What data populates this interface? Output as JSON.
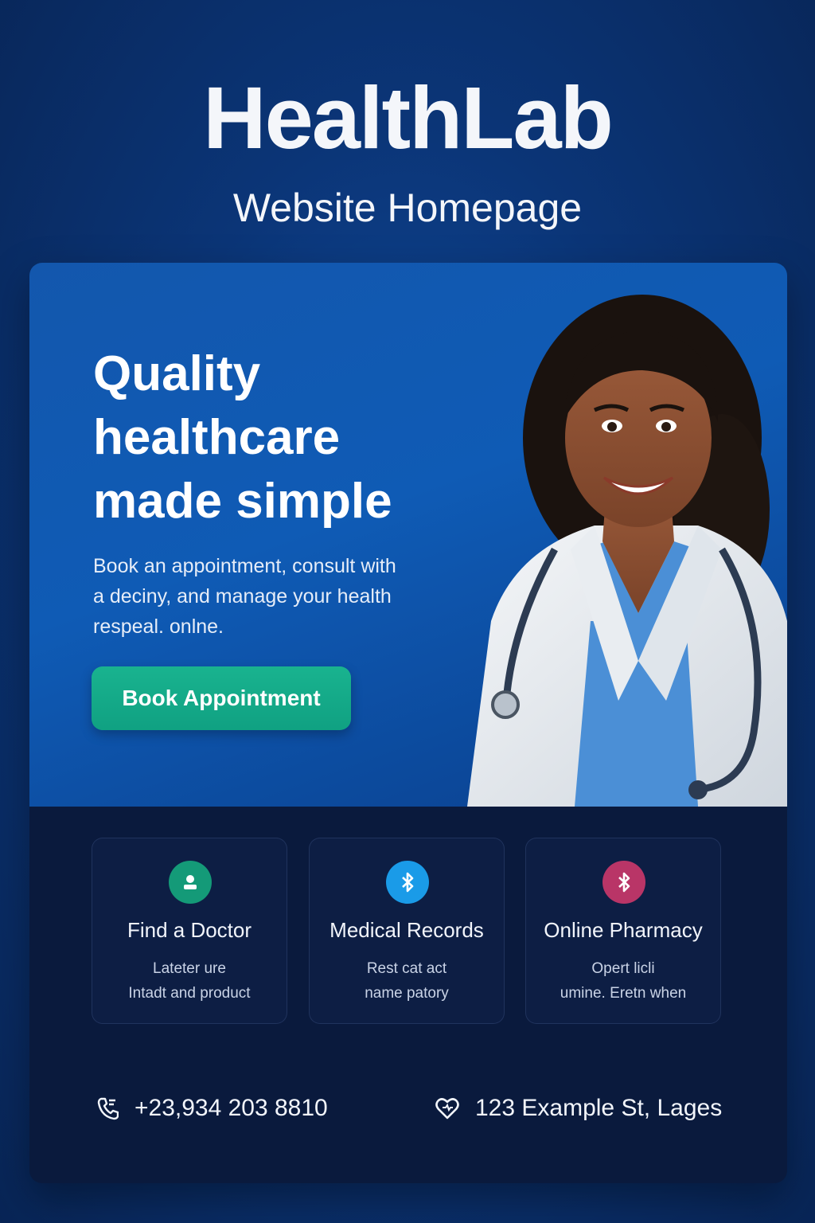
{
  "header": {
    "title": "HealthLab",
    "subtitle": "Website Homepage"
  },
  "hero": {
    "heading_lines": [
      "Quality",
      "healthcare",
      "made simple"
    ],
    "description_lines": [
      "Book an appointment, consult with",
      "a deciny, and manage your health",
      "respeal. onlne."
    ],
    "cta_label": "Book Appointment"
  },
  "services": [
    {
      "icon": "user-icon",
      "color": "#149a78",
      "title": "Find a Doctor",
      "description_lines": [
        "Lateter  ure",
        "Intadt and product"
      ]
    },
    {
      "icon": "bluetooth-icon",
      "color": "#1a9be8",
      "title": "Medical Records",
      "description_lines": [
        "Rest cat act",
        "name patory"
      ]
    },
    {
      "icon": "bluetooth-icon",
      "color": "#b93567",
      "title": "Online Pharmacy",
      "description_lines": [
        "Opert licli",
        "umine. Eretn when"
      ]
    }
  ],
  "contact": {
    "phone_icon": "phone-icon",
    "phone": "+23,934 203 8810",
    "address_icon": "heart-icon",
    "address": "123 Example St, Lages"
  },
  "colors": {
    "accent": "#14a887",
    "background": "#0b3577"
  }
}
